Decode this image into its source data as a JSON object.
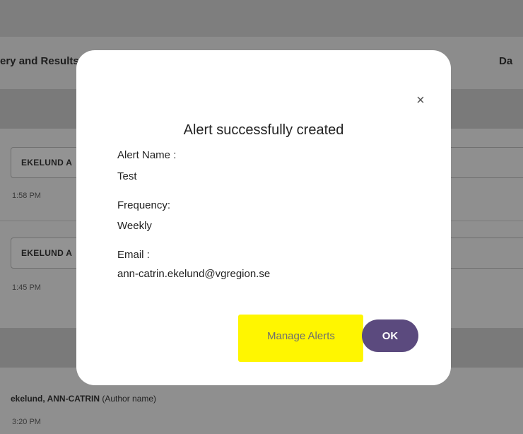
{
  "background": {
    "header_col_left": "ery and Results",
    "header_col_right": "Da",
    "rows": [
      {
        "chip_label": "EKELUND A",
        "time": "1:58 PM"
      },
      {
        "chip_label": "EKELUND A",
        "time": "1:45 PM"
      }
    ],
    "author": {
      "name": "ekelund, ANN-CATRIN",
      "suffix": " (Author name)",
      "time": "3:20 PM"
    }
  },
  "modal": {
    "close_symbol": "×",
    "title": "Alert successfully created",
    "alert_name_label": "Alert Name :",
    "alert_name_value": "Test",
    "frequency_label": "Frequency:",
    "frequency_value": "Weekly",
    "email_label": "Email :",
    "email_value": "ann-catrin.ekelund@vgregion.se",
    "manage_alerts_label": "Manage Alerts",
    "ok_label": "OK"
  },
  "colors": {
    "overlay_bg": "#8f8f8f",
    "modal_bg": "#ffffff",
    "ok_button": "#5b4a7e",
    "highlight": "#fff600"
  }
}
